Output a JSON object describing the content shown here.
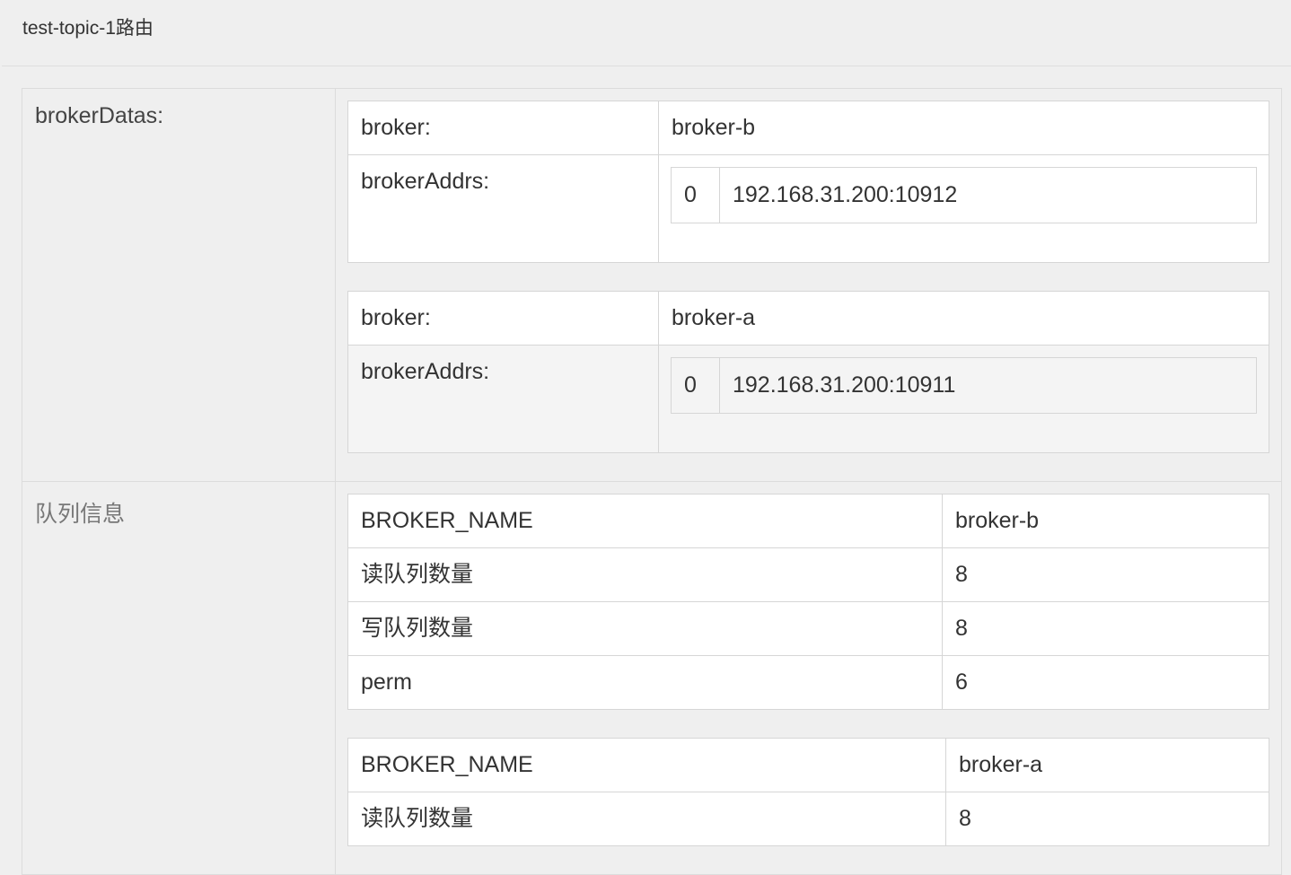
{
  "header": {
    "title": "test-topic-1路由"
  },
  "brokerDatas": {
    "label": "brokerDatas:",
    "items": [
      {
        "broker_label": "broker:",
        "broker": "broker-b",
        "addrs_label": "brokerAddrs:",
        "addr_index": "0",
        "addr": "192.168.31.200:10912"
      },
      {
        "broker_label": "broker:",
        "broker": "broker-a",
        "addrs_label": "brokerAddrs:",
        "addr_index": "0",
        "addr": "192.168.31.200:10911"
      }
    ]
  },
  "queueDatas": {
    "label": "队列信息",
    "items": [
      {
        "name_label": "BROKER_NAME",
        "name": "broker-b",
        "read_label": "读队列数量",
        "read": "8",
        "write_label": "写队列数量",
        "write": "8",
        "perm_label": "perm",
        "perm": "6"
      },
      {
        "name_label": "BROKER_NAME",
        "name": "broker-a",
        "read_label": "读队列数量",
        "read": "8"
      }
    ]
  }
}
